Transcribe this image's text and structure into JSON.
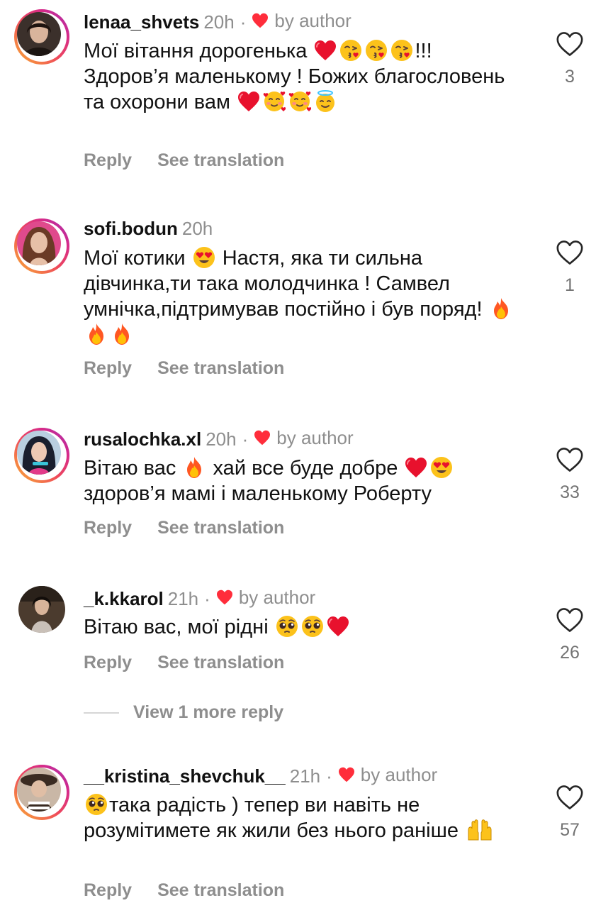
{
  "comments": [
    {
      "username": "lenaa_shvets",
      "time": "20h",
      "separator": "·",
      "by_author": "by author",
      "text_parts": [
        "Мої вітання дорогенька ",
        "!!! Здоров’я маленькому ! Божих благословень та охорони вам "
      ],
      "reply_label": "Reply",
      "translate_label": "See translation",
      "likes": "3"
    },
    {
      "username": "sofi.bodun",
      "time": "20h",
      "text_parts": [
        "Мої котики ",
        " Настя, яка ти сильна дівчинка,ти така молодчинка ! Самвел умнічка,підтримував постійно і був поряд! "
      ],
      "reply_label": "Reply",
      "translate_label": "See translation",
      "likes": "1"
    },
    {
      "username": "rusalochka.xl",
      "time": "20h",
      "separator": "·",
      "by_author": "by author",
      "text_parts": [
        "Вітаю вас ",
        " хай все буде добре ",
        "здоров’я мамі і маленькому Роберту"
      ],
      "reply_label": "Reply",
      "translate_label": "See translation",
      "likes": "33"
    },
    {
      "username": "_k.kkarol",
      "time": "21h",
      "separator": "·",
      "by_author": "by author",
      "text_parts": [
        "Вітаю вас, мої рідні "
      ],
      "reply_label": "Reply",
      "translate_label": "See translation",
      "likes": "26"
    },
    {
      "username": "__kristina_shevchuk__",
      "time": "21h",
      "separator": "·",
      "by_author": "by author",
      "text_parts": [
        "така радість ) тепер ви навіть не розумітимете як жили без нього раніше "
      ],
      "reply_label": "Reply",
      "translate_label": "See translation",
      "likes": "57"
    }
  ],
  "view_more_replies": "View 1 more reply",
  "colors": {
    "heart_red": "#ff2d3b",
    "muted_text": "#8e8e8e",
    "ring_gradient_start": "#f9b233",
    "ring_gradient_end": "#9b2fb4"
  },
  "icons": {
    "like": "heart-outline-icon",
    "author_like": "heart-filled-icon"
  }
}
